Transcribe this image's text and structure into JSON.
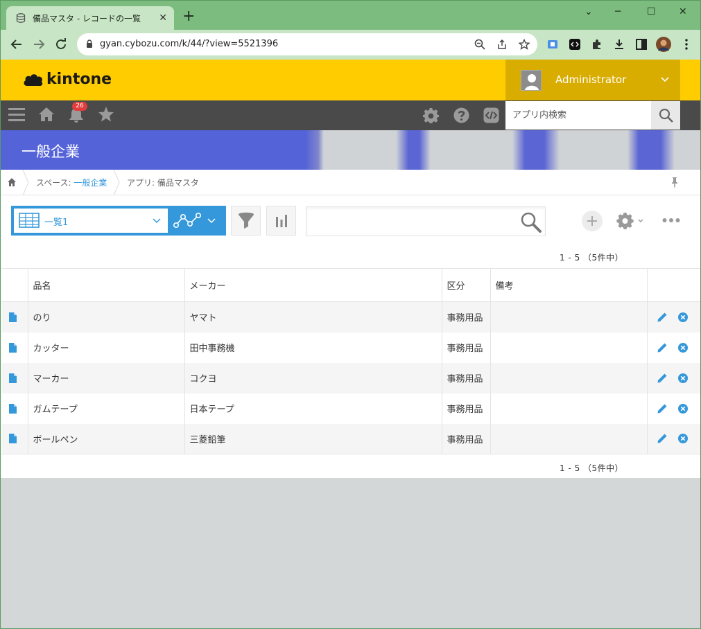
{
  "browser": {
    "tab_title": "備品マスタ - レコードの一覧",
    "tab_close": "✕",
    "new_tab": "+",
    "url": "gyan.cybozu.com/k/44/?view=5521396",
    "minimize": "⌄",
    "maximize": "─",
    "restore": "☐",
    "close": "✕"
  },
  "header": {
    "logo": "kintone",
    "user_name": "Administrator"
  },
  "nav": {
    "notification_count": "26",
    "app_search_placeholder": "アプリ内検索"
  },
  "space": {
    "title": "一般企業"
  },
  "breadcrumb": {
    "space_prefix": "スペース: ",
    "space_link": "一般企業",
    "app_prefix": "アプリ: ",
    "app_name": "備品マスタ"
  },
  "view": {
    "name": "一覧1",
    "record_count_top": "1 - 5 （5件中）",
    "record_count_bottom": "1 - 5 （5件中）"
  },
  "table": {
    "headers": [
      "品名",
      "メーカー",
      "区分",
      "備考"
    ],
    "rows": [
      {
        "name": "のり",
        "maker": "ヤマト",
        "category": "事務用品",
        "note": ""
      },
      {
        "name": "カッター",
        "maker": "田中事務機",
        "category": "事務用品",
        "note": ""
      },
      {
        "name": "マーカー",
        "maker": "コクヨ",
        "category": "事務用品",
        "note": ""
      },
      {
        "name": "ガムテープ",
        "maker": "日本テープ",
        "category": "事務用品",
        "note": ""
      },
      {
        "name": "ボールペン",
        "maker": "三菱鉛筆",
        "category": "事務用品",
        "note": ""
      }
    ]
  },
  "colors": {
    "kintone_yellow": "#ffcc00",
    "user_box": "#d9ac00",
    "nav_dark": "#4a4a4a",
    "accent_blue": "#3498db",
    "banner_blue": "#5563d8",
    "chrome_green": "#7cbd7f"
  },
  "icons": {
    "tab": "database-icon",
    "back": "arrow-left-icon",
    "forward": "arrow-right-icon",
    "reload": "reload-icon",
    "lock": "lock-icon",
    "zoom": "zoom-icon",
    "share": "share-icon",
    "bookmark": "star-icon",
    "menu": "hamburger-icon",
    "home": "home-icon",
    "notifications": "bell-icon",
    "favorites": "star-icon",
    "settings": "gear-icon",
    "help": "question-icon",
    "developer": "code-icon",
    "filter": "funnel-icon",
    "chart": "bar-chart-icon",
    "search": "magnifier-icon",
    "add": "plus-icon",
    "more": "ellipsis-icon",
    "record": "document-icon",
    "edit": "pencil-icon",
    "delete": "x-circle-icon"
  }
}
